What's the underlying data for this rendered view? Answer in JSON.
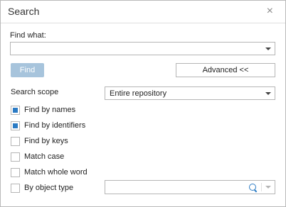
{
  "dialog": {
    "title": "Search",
    "close_glyph": "×",
    "find_what_label": "Find what:",
    "find_what_value": "",
    "find_button": "Find",
    "advanced_button": "Advanced <<",
    "search_scope_label": "Search scope",
    "search_scope_value": "Entire repository",
    "options": [
      {
        "label": "Find by names",
        "checked": true
      },
      {
        "label": "Find by identifiers",
        "checked": true
      },
      {
        "label": "Find by keys",
        "checked": false
      },
      {
        "label": "Match case",
        "checked": false
      },
      {
        "label": "Match whole word",
        "checked": false
      },
      {
        "label": "By object type",
        "checked": false
      }
    ],
    "object_type_value": ""
  },
  "icons": {
    "close": "close-icon",
    "dropdown": "chevron-down-icon",
    "search": "search-icon"
  },
  "colors": {
    "accent": "#2b7bc4",
    "find_button_disabled": "#a7c4dc",
    "border": "#b5b5b5"
  }
}
